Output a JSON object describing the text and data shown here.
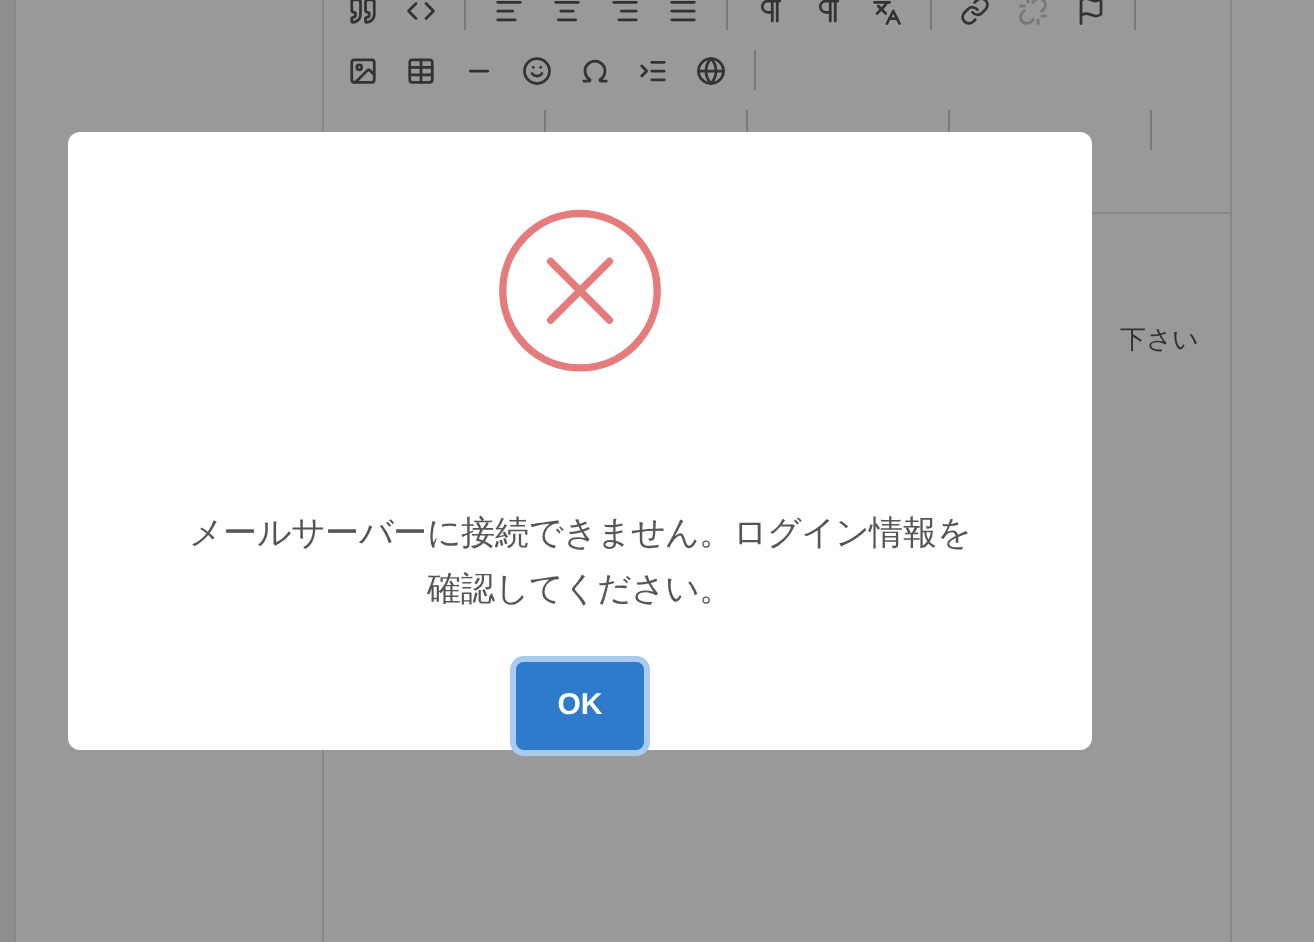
{
  "editor": {
    "body_text": "下さい"
  },
  "dialog": {
    "kind": "error",
    "message_lines": [
      "メールサーバーに接続できません。ログイン情報を",
      "確認してください。"
    ],
    "button": "OK"
  }
}
